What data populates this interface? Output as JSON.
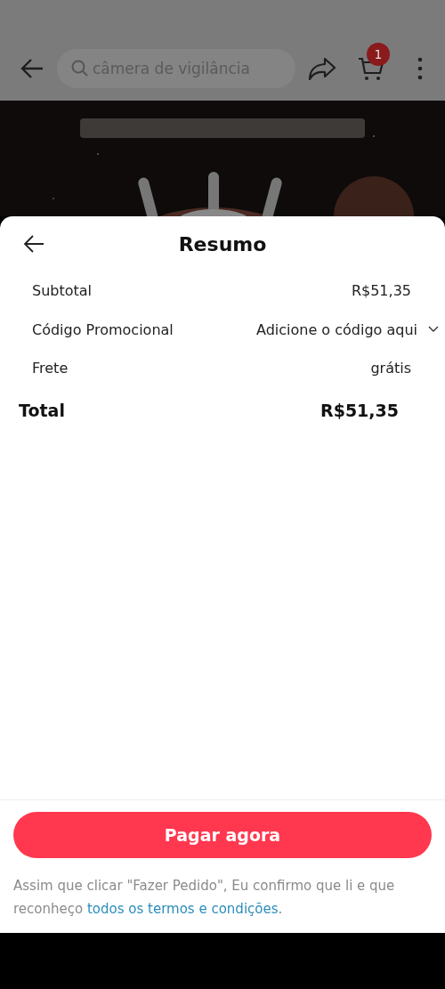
{
  "header": {
    "search_placeholder": "câmera de vigilância",
    "cart_count": "1"
  },
  "sheet": {
    "title": "Resumo",
    "rows": [
      {
        "kind": "value",
        "label": "Subtotal",
        "value": "R$51,35"
      },
      {
        "kind": "dropdown",
        "label": "Código Promocional",
        "value": "Adicione o código aqui"
      },
      {
        "kind": "value",
        "label": "Frete",
        "value": "grátis"
      }
    ],
    "total": {
      "label": "Total",
      "value": "R$51,35"
    },
    "pay_button": "Pagar agora",
    "terms": {
      "text": "Assim que clicar \"Fazer Pedido\", Eu confirmo que li e que reconheço",
      "link": "todos os termos e condições",
      "end": "."
    }
  }
}
